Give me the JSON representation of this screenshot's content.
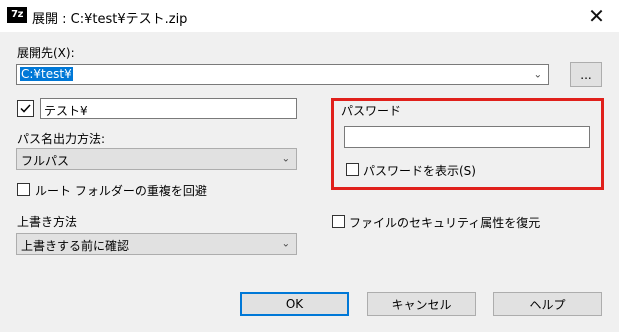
{
  "window": {
    "icon_text": "7z",
    "title": "展開 : C:¥test¥テスト.zip"
  },
  "extract_to": {
    "label": "展開先(X):",
    "value": "C:¥test¥",
    "browse_label": "..."
  },
  "subfolder": {
    "checked": true,
    "value": "テスト¥"
  },
  "path_mode": {
    "label": "パス名出力方法:",
    "value": "フルパス"
  },
  "eliminate_root": {
    "label": "ルート フォルダーの重複を回避",
    "checked": false
  },
  "overwrite": {
    "label": "上書き方法",
    "value": "上書きする前に確認"
  },
  "password": {
    "label": "パスワード",
    "value": "",
    "show_label": "パスワードを表示(S)",
    "show_checked": false,
    "highlight_color": "#e0201b"
  },
  "security": {
    "label": "ファイルのセキュリティ属性を復元",
    "checked": false
  },
  "buttons": {
    "ok": "OK",
    "cancel": "キャンセル",
    "help": "ヘルプ"
  }
}
